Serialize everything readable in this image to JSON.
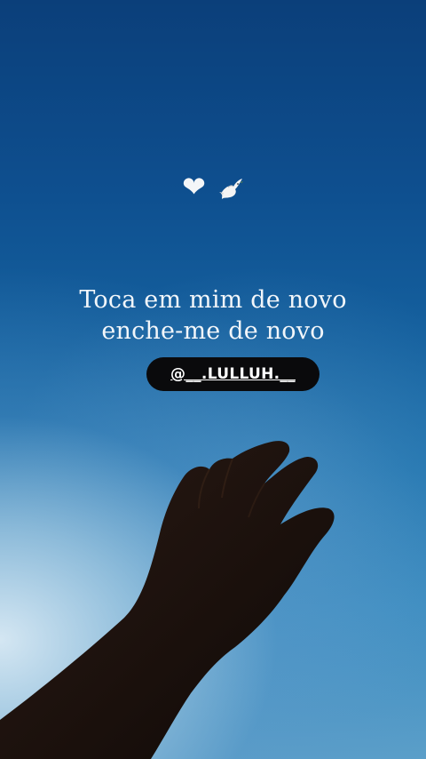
{
  "story": {
    "emojis": [
      {
        "name": "white-heart-icon",
        "glyph": "🤍"
      },
      {
        "name": "dove-icon",
        "glyph": "🕊️"
      }
    ],
    "caption_line1": "Toca em mim de novo",
    "caption_line2": "enche-me de novo",
    "mention": "@__.LULLUH.__"
  },
  "colors": {
    "sky_top": "#0b3f7a",
    "sky_bottom": "#5b9fc9",
    "mention_bg": "#0a0a0c",
    "text": "#f2f6fa"
  }
}
